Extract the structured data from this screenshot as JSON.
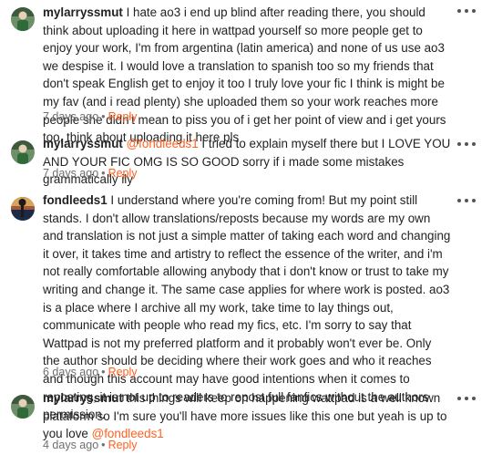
{
  "comments": [
    {
      "username": "mylarryssmut",
      "mention": "",
      "text": "I hate ao3 i end up blind after reading there, you should think about uploading it here in wattpad yourself so more people get to enjoy your work, I'm from argentina (latin america) and none of us use ao3 we despise it. I would love a translation to spanish too so my friends that don't speak English get to enjoy it too I truly love your fic I think is might be my fav (and i read plenty) she uploaded them so your work reaches more people she didn't mean to piss you of i get her point of view and i get yours too, think about uploading it here pls",
      "time": "7 days ago",
      "reply": "Reply",
      "avatar": "avatar-green-person"
    },
    {
      "username": "mylarryssmut",
      "mention": "@fondleeds1",
      "text": " I tried to explain myself there but I LOVE YOU AND YOUR FIC OMG IS SO GOOD sorry if i made some mistakes grammatically ily",
      "time": "7 days ago",
      "reply": "Reply",
      "avatar": "avatar-green-person"
    },
    {
      "username": "fondleeds1",
      "mention": "",
      "text": "I understand where you're coming from! But my point still stands. I don't allow translations/reposts because my words are my own and translation is not just a simple matter of taking each word and changing it over, it takes time and artistry to reflect the essence of the writer, and i'm not really comfortable allowing anybody that i don't know or trust to take my writing and change it. The same case applies for where work is posted. ao3 is a place where I archive all my work, take time to lay things out, communicate with people who read my fics, etc. I'm sorry to say that Wattpad is not my preferred platform and it probably won't ever be. Only the author should be deciding where their work goes and who it reaches and though this account may have good intentions when it comes to reposting, it is not up to readers to repost full fanfics without the authors permission.",
      "time": "6 days ago",
      "reply": "Reply",
      "avatar": "avatar-sunset-landscape"
    },
    {
      "username": "mylarryssmut",
      "mention": "",
      "text": "this things will keep on happening wattpad is a well known plataform so I'm sure you'll have more issues like this one but yeah is up to you love ",
      "mention_end": "@fondleeds1",
      "time": "4 days ago",
      "reply": "Reply",
      "avatar": "avatar-green-person"
    }
  ],
  "colors": {
    "accent": "#ff6122",
    "meta": "#6f6f6f",
    "text": "#222222"
  },
  "separator": "•"
}
